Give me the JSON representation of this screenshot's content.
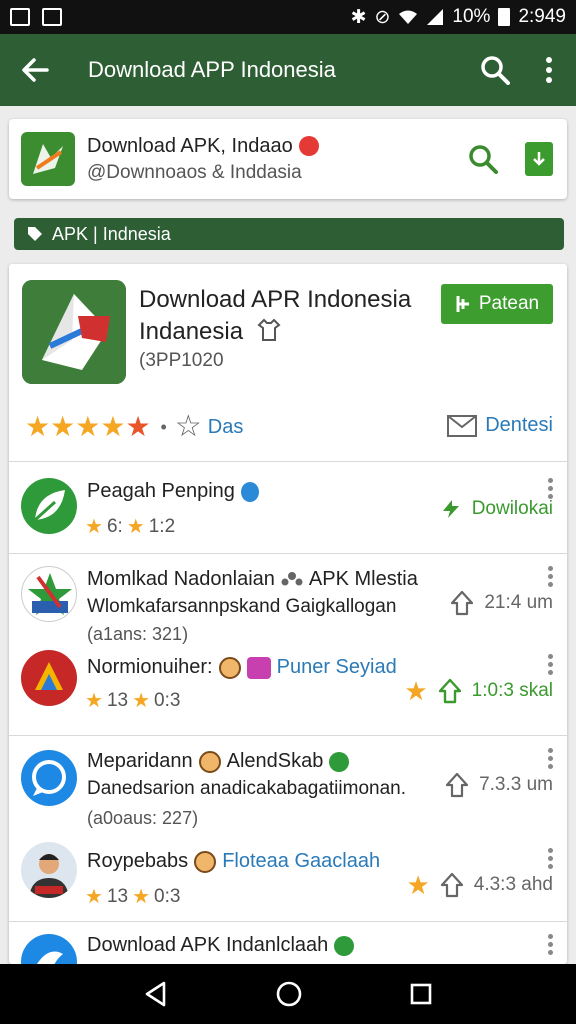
{
  "status_bar": {
    "battery": "10%",
    "time": "2:949"
  },
  "app_bar": {
    "title": "Download APP Indonesia",
    "back_icon": "arrow-left-icon",
    "search_icon": "search-icon",
    "menu_icon": "more-vert-icon"
  },
  "search_card": {
    "title": "Download APK, Indaao",
    "subtitle": "@Downnoaos & Inddasia"
  },
  "chip_bar": {
    "label": "APK | Indnesia"
  },
  "hero": {
    "title": "Download APR Indonesia Indanesia",
    "subtitle": "(3PP1020",
    "install_label": "Patean",
    "rating": 5,
    "rate_label": "Das",
    "contact_label": "Dentesi"
  },
  "rows": [
    {
      "title": "Peagah Penping",
      "rating_a": "6:",
      "rating_b": "1:2",
      "action": "Dowilokai"
    },
    {
      "title": "Momlkad Nadonlaian",
      "title_suffix": "APK Mlestia",
      "desc": "Wlomkafarsannpskand Gaigkallogan",
      "meta": "(a1ans: 321)",
      "size": "21:4 um"
    },
    {
      "title": "Normionuiher:",
      "link": "Puner Seyiad",
      "rating_a": "13",
      "rating_b": "0:3",
      "size": "1:0:3 skal"
    },
    {
      "title": "Meparidann",
      "title_suffix": "AlendSkab",
      "desc": "Danedsarion anadicakabagatiimonan.",
      "meta": "(a0oaus: 227)",
      "size": "7.3.3 um"
    },
    {
      "title": "Roypebabs",
      "link": "Floteaa Gaaclaah",
      "rating_a": "13",
      "rating_b": "0:3",
      "size": "4.3:3 ahd"
    },
    {
      "title": "Download APK Indanlclaah"
    }
  ],
  "colors": {
    "primary": "#2d5e34",
    "accent_green": "#3d9d2f",
    "link_blue": "#2a7ab8",
    "star": "#f5a623"
  }
}
